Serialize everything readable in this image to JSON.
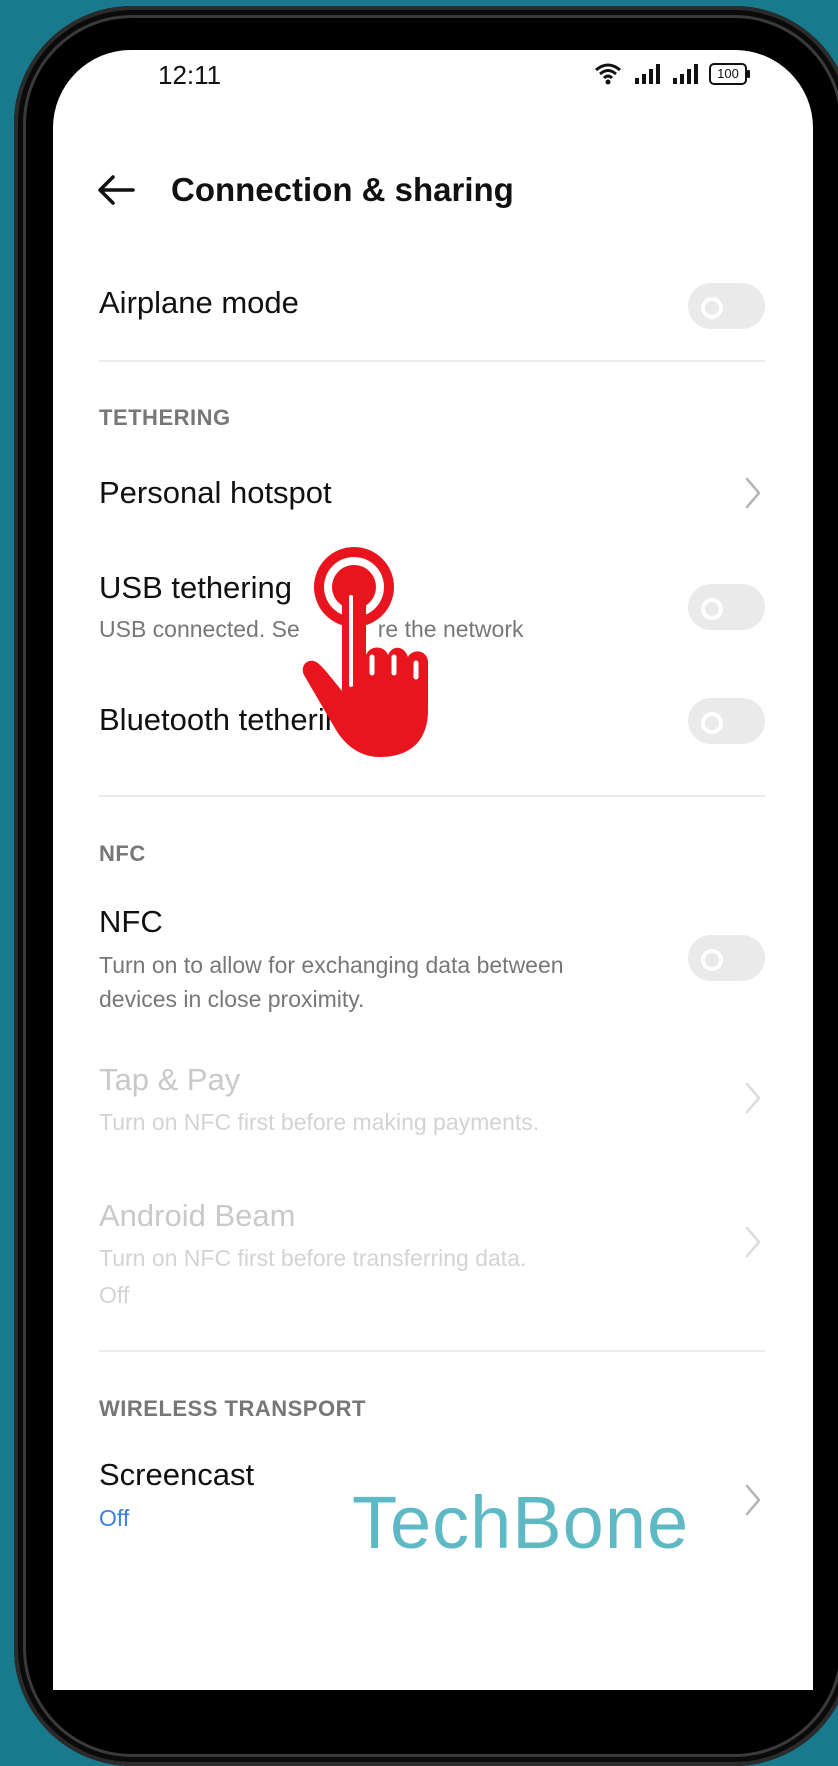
{
  "status_bar": {
    "time": "12:11",
    "battery": "100"
  },
  "header": {
    "title": "Connection & sharing"
  },
  "airplane": {
    "title": "Airplane mode",
    "enabled": false
  },
  "tethering": {
    "section": "TETHERING",
    "hotspot": {
      "title": "Personal hotspot"
    },
    "usb": {
      "title": "USB tethering",
      "subtitle": "USB connected. Se",
      "subtitle_tail": "re the network",
      "enabled": false
    },
    "bluetooth": {
      "title": "Bluetooth tethering",
      "enabled": false
    }
  },
  "nfc": {
    "section": "NFC",
    "nfc_item": {
      "title": "NFC",
      "subtitle_line1": "Turn on to allow for exchanging data between",
      "subtitle_line2": "devices in close proximity.",
      "enabled": false
    },
    "tap_pay": {
      "title": "Tap & Pay",
      "subtitle": "Turn on NFC first before making payments."
    },
    "beam": {
      "title": "Android Beam",
      "subtitle": "Turn on NFC first before transferring data.",
      "status": "Off"
    }
  },
  "wireless": {
    "section": "WIRELESS TRANSPORT",
    "screencast": {
      "title": "Screencast",
      "status": "Off"
    }
  },
  "watermark": "TechBone",
  "colors": {
    "background": "#187a8c",
    "accent_blue": "#3d7fe0",
    "tap_red": "#e8151e",
    "watermark": "#5fb9c4"
  },
  "icons": [
    "wifi-icon",
    "signal-icon",
    "battery-icon",
    "back-arrow-icon",
    "chevron-right-icon",
    "tap-hand-icon"
  ]
}
